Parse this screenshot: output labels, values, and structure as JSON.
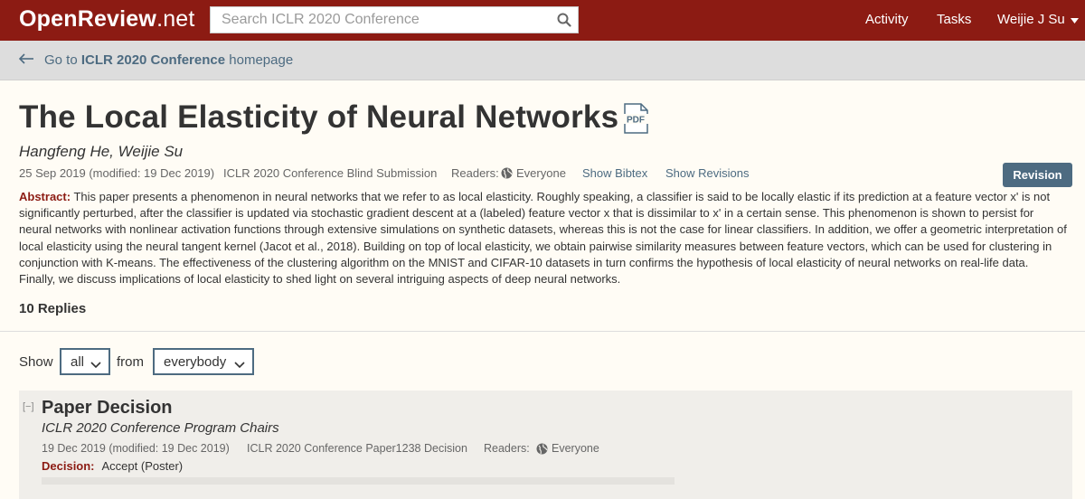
{
  "header": {
    "logo_bold": "OpenReview",
    "logo_rest": ".net",
    "search_placeholder": "Search ICLR 2020 Conference",
    "nav": {
      "activity": "Activity",
      "tasks": "Tasks",
      "user": "Weijie J Su"
    }
  },
  "breadcrumb": {
    "prefix": "Go to",
    "venue": "ICLR 2020 Conference",
    "suffix": "homepage"
  },
  "paper": {
    "title": "The Local Elasticity of Neural Networks",
    "authors": "Hangfeng He, Weijie Su",
    "date": "25 Sep 2019 (modified: 19 Dec 2019)",
    "venue": "ICLR 2020 Conference Blind Submission",
    "readers_label": "Readers:",
    "readers_value": "Everyone",
    "show_bibtex": "Show Bibtex",
    "show_revisions": "Show Revisions",
    "revision_button": "Revision",
    "abstract_label": "Abstract:",
    "abstract": "This paper presents a phenomenon in neural networks that we refer to as local elasticity. Roughly speaking, a classifier is said to be locally elastic if its prediction at a feature vector x' is not significantly perturbed, after the classifier is updated via stochastic gradient descent at a (labeled) feature vector x that is dissimilar to x' in a certain sense. This phenomenon is shown to persist for neural networks with nonlinear activation functions through extensive simulations on synthetic datasets, whereas this is not the case for linear classifiers. In addition, we offer a geometric interpretation of local elasticity using the neural tangent kernel (Jacot et al., 2018). Building on top of local elasticity, we obtain pairwise similarity measures between feature vectors, which can be used for clustering in conjunction with K-means. The effectiveness of the clustering algorithm on the MNIST and CIFAR-10 datasets in turn confirms the hypothesis of local elasticity of neural networks on real-life data. Finally, we discuss implications of local elasticity to shed light on several intriguing aspects of deep neural networks."
  },
  "replies": {
    "count_label": "10 Replies",
    "filter": {
      "show_label": "Show",
      "show_value": "all",
      "from_label": "from",
      "from_value": "everybody"
    }
  },
  "note": {
    "collapse": "[−]",
    "title": "Paper Decision",
    "signature": "ICLR 2020 Conference Program Chairs",
    "date": "19 Dec 2019 (modified: 19 Dec 2019)",
    "invitation": "ICLR 2020 Conference Paper1238 Decision",
    "readers_label": "Readers:",
    "readers_value": "Everyone",
    "decision_label": "Decision:",
    "decision_value": "Accept (Poster)"
  },
  "colors": {
    "brand": "#8c1b13",
    "link": "#4d6b81",
    "background": "#fffcf5"
  },
  "icons": [
    "search-icon",
    "arrow-left-icon",
    "pdf-icon",
    "globe-icon",
    "caret-down-icon",
    "chevron-down-icon"
  ]
}
